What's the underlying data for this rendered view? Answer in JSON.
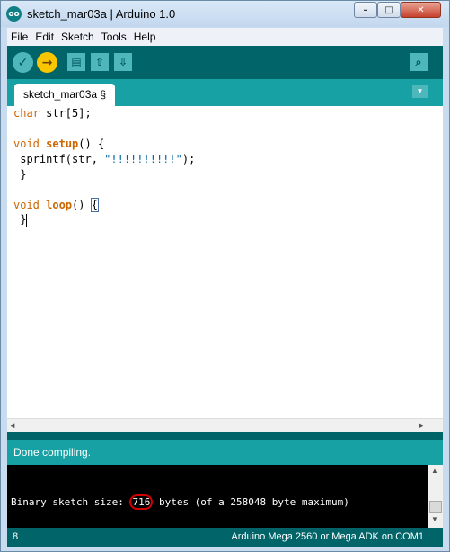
{
  "window": {
    "title": "sketch_mar03a | Arduino 1.0",
    "app_icon": "oo",
    "controls": {
      "minimize": "–",
      "maximize": "□",
      "close": "✕"
    }
  },
  "menu": [
    "File",
    "Edit",
    "Sketch",
    "Tools",
    "Help"
  ],
  "toolbar": {
    "verify_icon": "✓",
    "upload_icon": "→",
    "new_icon": "▤",
    "open_icon": "⇧",
    "save_icon": "⇩",
    "serial_icon": "⌕"
  },
  "tabs": [
    {
      "label": "sketch_mar03a §"
    }
  ],
  "tab_menu_icon": "▼",
  "editor": {
    "lines": {
      "l1_type": "char",
      "l1_rest": " str[5];",
      "l3_type": "void",
      "l3_fn": "setup",
      "l3_rest": "() {",
      "l4_pre": " sprintf(str, ",
      "l4_str": "\"!!!!!!!!!!\"",
      "l4_post": ");",
      "l5": " }",
      "l7_type": "void",
      "l7_fn": "loop",
      "l7_rest": "() ",
      "l7_brace": "{",
      "l8": " }"
    }
  },
  "hscroll": {
    "left_arrow": "◄",
    "right_arrow": "►"
  },
  "status": "Done compiling.",
  "console": {
    "before": "Binary sketch size: ",
    "size": "716",
    "after": " bytes (of a 258048 byte maximum)"
  },
  "vscroll": {
    "up_arrow": "▲",
    "down_arrow": "▼"
  },
  "footer": {
    "line_number": "8",
    "board": "Arduino Mega 2560 or Mega ADK on COM1"
  }
}
